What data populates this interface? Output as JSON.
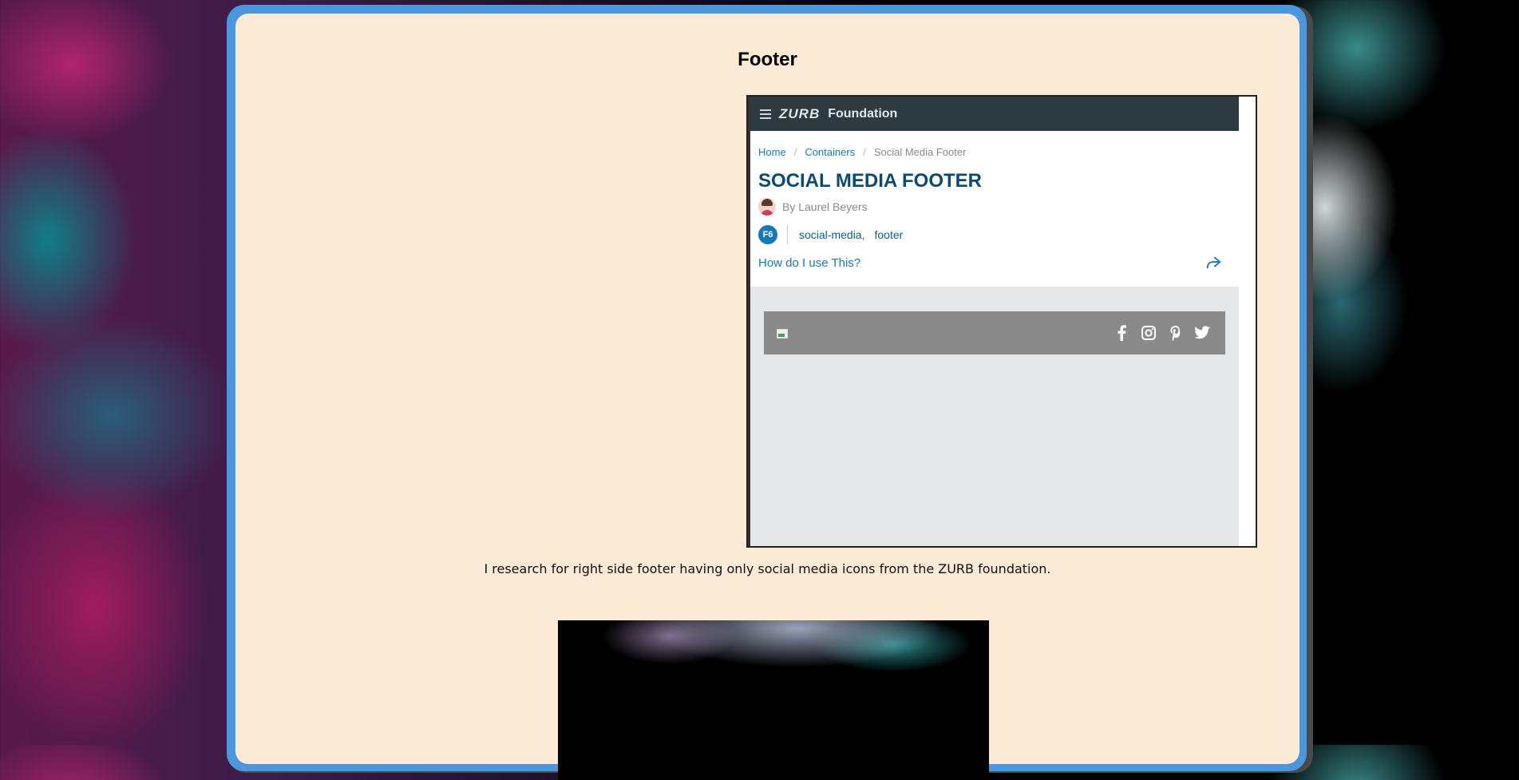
{
  "panel": {
    "title": "Footer",
    "description": "I research for right side footer having only social media icons from the ZURB foundation."
  },
  "screenshot": {
    "brand": "ZURB",
    "brand_sub": "Foundation",
    "breadcrumb": {
      "home": "Home",
      "separator": "/",
      "containers": "Containers",
      "current": "Social Media Footer"
    },
    "heading": "SOCIAL MEDIA FOOTER",
    "author": "By Laurel Beyers",
    "badge": "F6",
    "tags": [
      "social-media",
      "footer"
    ],
    "tag_separator": ",",
    "howto": "How do I use This?",
    "social_icons": [
      "facebook-icon",
      "instagram-icon",
      "pinterest-icon",
      "twitter-icon"
    ]
  },
  "colors": {
    "panel_bg": "#fbebd6",
    "panel_border": "#4a97dd",
    "topbar": "#2d3a40",
    "link": "#1779ba",
    "heading": "#0c4a6e",
    "demo_bar": "#8a8a8a"
  }
}
